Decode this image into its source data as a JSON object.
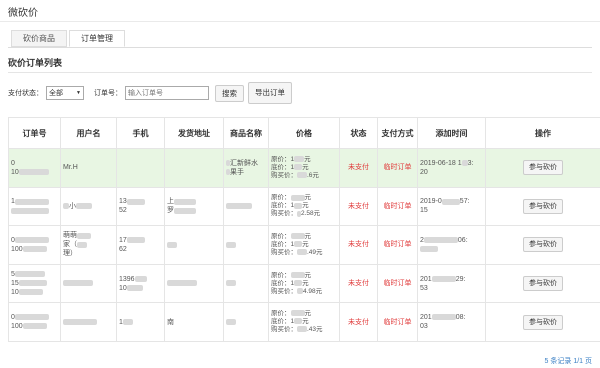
{
  "app_title": "微砍价",
  "tabs": [
    {
      "label": "砍价商品",
      "active": false
    },
    {
      "label": "订单管理",
      "active": true
    }
  ],
  "section_title": "砍价订单列表",
  "filters": {
    "status_label": "支付状态：",
    "status_value": "全部",
    "order_label": "订单号：",
    "order_placeholder": "输入订单号",
    "search_button": "搜索",
    "export_button": "导出订单"
  },
  "table": {
    "headers": [
      "订单号",
      "用户名",
      "手机",
      "发货地址",
      "商品名称",
      "价格",
      "状态",
      "支付方式",
      "添加时间",
      "操作"
    ],
    "rows": [
      {
        "order_no": "0",
        "order_no_2": "10",
        "username": "Mr.H",
        "phone": "",
        "phone_2": "",
        "address": "",
        "product": "汇新鲜水",
        "product_2": "果手",
        "price_original": "原价：1",
        "price_original_suffix": "元",
        "price_floor": "底价：1",
        "price_floor_suffix": "元",
        "price_paid": "购买价：",
        "price_paid_suffix": ".6元",
        "status": "未支付",
        "pay_method": "临时订单",
        "time": "2019-06-18 1",
        "time_suffix": "3:",
        "time_2": "20",
        "action": "参与砍价",
        "highlight": true
      },
      {
        "order_no": "1",
        "order_no_2": "",
        "username": "小",
        "phone": "13",
        "phone_2": "52",
        "address": "上",
        "address_2": "罗",
        "product": "",
        "product_2": "",
        "price_original": "原价：",
        "price_original_suffix": "元",
        "price_floor": "底价：1",
        "price_floor_suffix": "元",
        "price_paid": "购买价：",
        "price_paid_suffix": "2.58元",
        "status": "未支付",
        "pay_method": "临时订单",
        "time": "2019-0",
        "time_suffix": "57:",
        "time_2": "15",
        "action": "参与砍价",
        "highlight": false
      },
      {
        "order_no": "0",
        "order_no_2": "100",
        "username": "萌萌",
        "username_2": "家（",
        "username_3": "理）",
        "phone": "17",
        "phone_2": "62",
        "address": "",
        "address_2": "",
        "product": "",
        "product_2": "",
        "price_original": "原价：",
        "price_original_suffix": "元",
        "price_floor": "底价：1",
        "price_floor_suffix": "元",
        "price_paid": "购买价：",
        "price_paid_suffix": ".49元",
        "status": "未支付",
        "pay_method": "临时订单",
        "time": "2",
        "time_suffix": "06:",
        "time_2": "",
        "action": "参与砍价",
        "highlight": false
      },
      {
        "order_no": "5",
        "order_no_2": "15",
        "order_no_3": "10",
        "username": "",
        "username_2": "",
        "username_3": "",
        "phone": "1396",
        "phone_2": "10",
        "address": "",
        "address_2": "",
        "product": "",
        "product_2": "",
        "price_original": "原价：",
        "price_original_suffix": "元",
        "price_floor": "底价：1",
        "price_floor_suffix": "元",
        "price_paid": "购买价：",
        "price_paid_suffix": "4.98元",
        "status": "未支付",
        "pay_method": "临时订单",
        "time": "201",
        "time_suffix": "29:",
        "time_2": "53",
        "action": "参与砍价",
        "highlight": false
      },
      {
        "order_no": "0",
        "order_no_2": "100",
        "username": "",
        "phone": "1",
        "phone_2": "",
        "address": "南",
        "address_2": "",
        "product": "",
        "product_2": "",
        "price_original": "原价：",
        "price_original_suffix": "元",
        "price_floor": "底价：1",
        "price_floor_suffix": "元",
        "price_paid": "购买价：",
        "price_paid_suffix": ".43元",
        "status": "未支付",
        "pay_method": "临时订单",
        "time": "201",
        "time_suffix": "08:",
        "time_2": "03",
        "action": "参与砍价",
        "highlight": false
      }
    ]
  },
  "pagination": "5 条记录 1/1 页",
  "colors": {
    "highlight_row": "#e8f6e3",
    "status_red": "#e03b3b",
    "link_blue": "#3a7fc4"
  }
}
